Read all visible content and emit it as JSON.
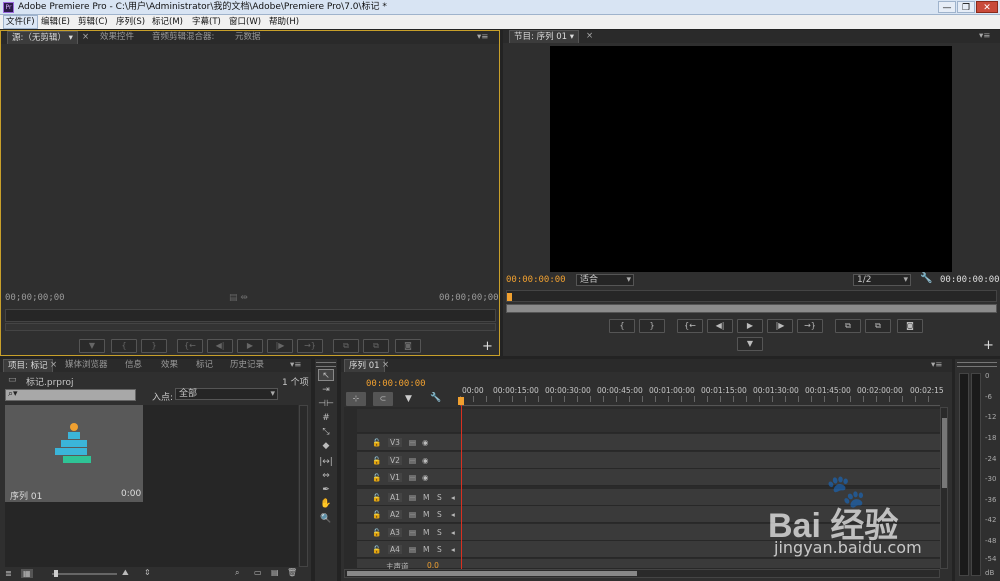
{
  "window": {
    "title": "Adobe Premiere Pro - C:\\用户\\Administrator\\我的文档\\Adobe\\Premiere Pro\\7.0\\标记 *",
    "min": "—",
    "max": "❐",
    "close": "✕"
  },
  "menu": [
    "文件(F)",
    "编辑(E)",
    "剪辑(C)",
    "序列(S)",
    "标记(M)",
    "字幕(T)",
    "窗口(W)",
    "帮助(H)"
  ],
  "source": {
    "tabs": [
      "源:（无剪辑）",
      "效果控件",
      "音频剪辑混合器:",
      "元数据"
    ],
    "tc_left": "00;00;00;00",
    "tc_right": "00;00;00;00",
    "buttons": [
      "▼",
      "{",
      "}",
      "{←",
      "◀|",
      "▶",
      "|▶",
      "→}",
      "⧉",
      "⧉",
      "◙"
    ],
    "add": "+"
  },
  "program": {
    "tab": "节目: 序列 01",
    "tc_left": "00:00:00:00",
    "fit": "适合",
    "res": "1/2",
    "tc_right": "00:00:00:00",
    "buttons": [
      "{",
      "}",
      "{←",
      "◀|",
      "▶",
      "|▶",
      "→}",
      "⧉",
      "⧉",
      "◙"
    ],
    "marker": "▼",
    "add": "+"
  },
  "project": {
    "tabs": [
      "项目: 标记",
      "媒体浏览器",
      "信息",
      "效果",
      "标记",
      "历史记录"
    ],
    "file": "标记.prproj",
    "count": "1 个项",
    "inpoint_label": "入点:",
    "inpoint_value": "全部",
    "item_name": "序列 01",
    "item_duration": "0:00"
  },
  "timeline": {
    "tab": "序列 01",
    "tc": "00:00:00:00",
    "ruler": [
      "00:00",
      "00:00:15:00",
      "00:00:30:00",
      "00:00:45:00",
      "00:01:00:00",
      "00:01:15:00",
      "00:01:30:00",
      "00:01:45:00",
      "00:02:00:00",
      "00:02:15"
    ],
    "video_tracks": [
      "V3",
      "V2",
      "V1"
    ],
    "audio_tracks": [
      "A1",
      "A2",
      "A3",
      "A4"
    ],
    "master": "主声道",
    "master_val": "0.0"
  },
  "meter": {
    "labels": [
      "0",
      "-6",
      "-12",
      "-18",
      "-24",
      "-30",
      "-36",
      "-42",
      "-48",
      "-54",
      "dB"
    ]
  },
  "watermark": {
    "brand": "Bai 经验",
    "url": "jingyan.baidu.com"
  },
  "colors": {
    "accent": "#f0a030",
    "panel": "#2f2f2f",
    "bg": "#232323"
  }
}
